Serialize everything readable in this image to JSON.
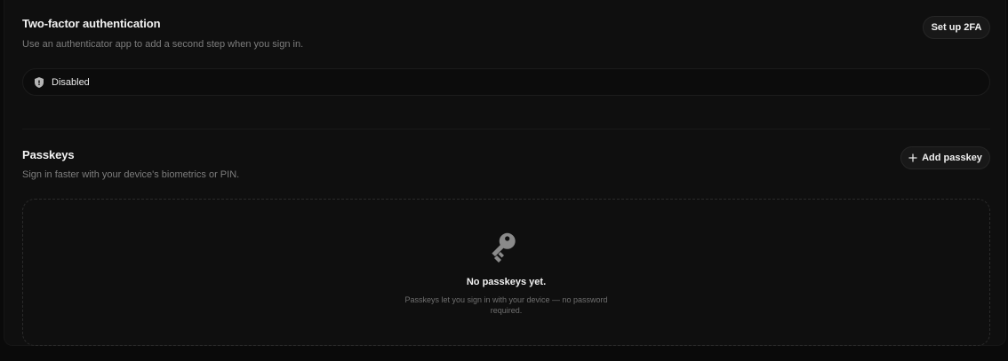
{
  "two_factor": {
    "title": "Two-factor authentication",
    "description": "Use an authenticator app to add a second step when you sign in.",
    "button_label": "Set up 2FA",
    "status": {
      "icon": "shield-icon",
      "label": "Disabled"
    }
  },
  "passkeys": {
    "title": "Passkeys",
    "description": "Sign in faster with your device's biometrics or PIN.",
    "button_label": "Add passkey",
    "button_icon": "plus-icon",
    "empty_state": {
      "icon": "key-icon",
      "title": "No passkeys yet.",
      "description": "Passkeys let you sign in with your device — no password required."
    }
  },
  "colors": {
    "background": "#0a0a0a",
    "card": "#0f0f0f",
    "text_primary": "#f2f2f2",
    "text_secondary": "#7d7d7d",
    "icon_muted": "#8a8a8a"
  }
}
